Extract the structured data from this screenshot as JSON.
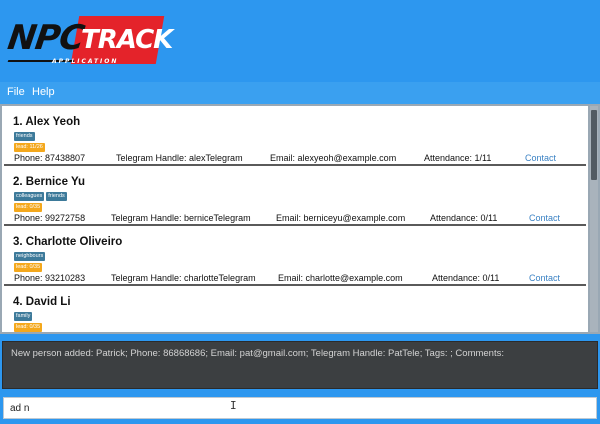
{
  "app": {
    "logo_npc": "NPC",
    "logo_track": "TRACK",
    "logo_sub": "APPLICATION"
  },
  "menu": {
    "file": "File",
    "help": "Help"
  },
  "persons": [
    {
      "title": "1.  Alex Yeoh",
      "tags": [
        "friends"
      ],
      "role": "lead: 11/26",
      "phone": "Phone: 87438807",
      "telegram": "Telegram Handle: alexTelegram",
      "email": "Email: alexyeoh@example.com",
      "attendance": "Attendance: 1/11",
      "contact": "Contact"
    },
    {
      "title": "2.  Bernice Yu",
      "tags": [
        "colleagues",
        "friends"
      ],
      "role": "lead: 0/35",
      "phone": "Phone: 99272758",
      "telegram": "Telegram Handle: berniceTelegram",
      "email": "Email: berniceyu@example.com",
      "attendance": "Attendance: 0/11",
      "contact": "Contact"
    },
    {
      "title": "3.  Charlotte Oliveiro",
      "tags": [
        "neighbours"
      ],
      "role": "lead: 0/35",
      "phone": "Phone: 93210283",
      "telegram": "Telegram Handle: charlotteTelegram",
      "email": "Email: charlotte@example.com",
      "attendance": "Attendance: 0/11",
      "contact": "Contact"
    },
    {
      "title": "4.  David Li",
      "tags": [
        "family"
      ],
      "role": "lead: 0/35"
    }
  ],
  "result": {
    "text": "New person added: Patrick; Phone: 86868686; Email: pat@gmail.com; Telegram Handle: PatTele; Tags: ; Comments:"
  },
  "command": {
    "value": "ad n"
  },
  "colors": {
    "background": "#2d97ef",
    "logo_red": "#e4232a",
    "tag": "#3d7a9a",
    "role": "#f4a81c",
    "link": "#3b82c4",
    "result_bg": "#3c3f41"
  }
}
